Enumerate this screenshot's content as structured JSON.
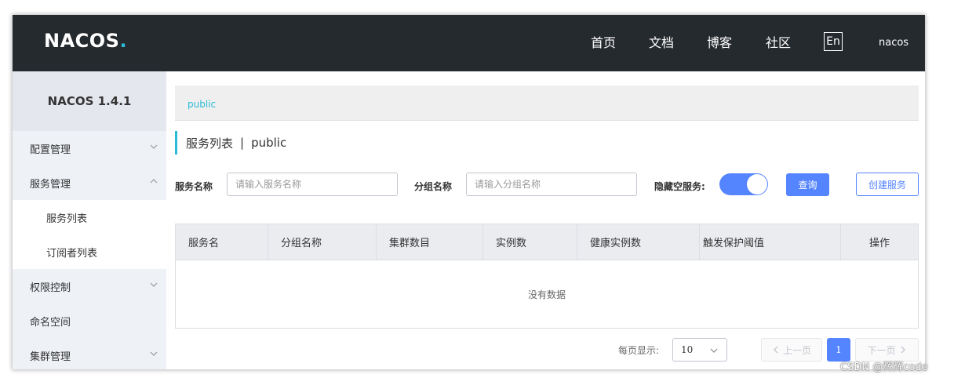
{
  "header": {
    "logo": "NACOS.",
    "nav": [
      "首页",
      "文档",
      "博客",
      "社区"
    ],
    "lang": "En",
    "user": "nacos"
  },
  "sidebar": {
    "version": "NACOS 1.4.1",
    "items": [
      {
        "label": "配置管理",
        "chevron": "down"
      },
      {
        "label": "服务管理",
        "chevron": "up"
      },
      {
        "label": "服务列表"
      },
      {
        "label": "订阅者列表"
      },
      {
        "label": "权限控制",
        "chevron": "down"
      },
      {
        "label": "命名空间"
      },
      {
        "label": "集群管理",
        "chevron": "down"
      }
    ]
  },
  "breadcrumb": "public",
  "page": {
    "title": "服务列表",
    "separator": "|",
    "namespace": "public"
  },
  "filters": {
    "service_label": "服务名称",
    "service_placeholder": "请输入服务名称",
    "group_label": "分组名称",
    "group_placeholder": "请输入分组名称",
    "hide_empty_label": "隐藏空服务:",
    "hide_empty_on": true,
    "query_button": "查询",
    "create_button": "创建服务"
  },
  "table": {
    "columns": [
      "服务名",
      "分组名称",
      "集群数目",
      "实例数",
      "健康实例数",
      "触发保护阈值",
      "操作"
    ],
    "empty_text": "没有数据"
  },
  "pagination": {
    "per_page_label": "每页显示:",
    "page_size": "10",
    "prev": "上一页",
    "current": "1",
    "next": "下一页"
  },
  "watermark": "CSDN @辉辉code",
  "colors": {
    "header_bg": "#252a2f",
    "accent": "#2bbbd6",
    "primary": "#5584ff",
    "sidebar_bg": "#eef1f6"
  }
}
